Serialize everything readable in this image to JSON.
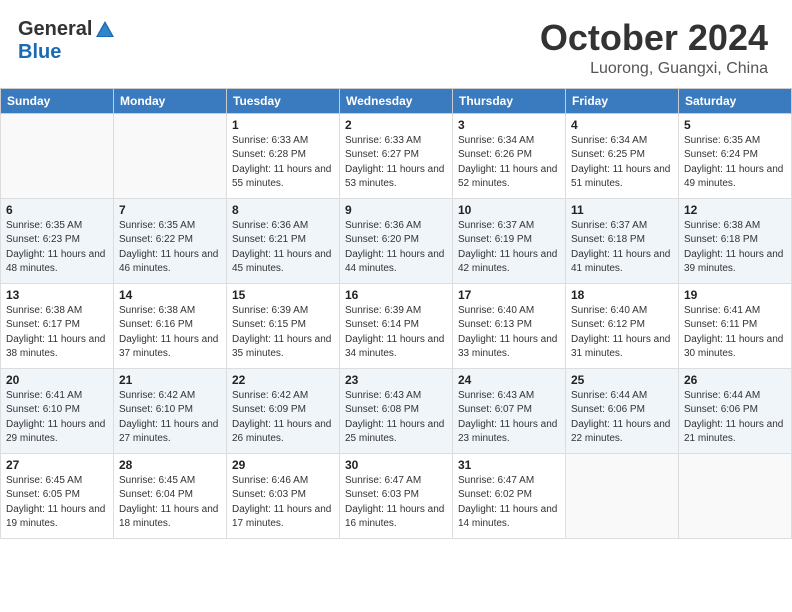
{
  "header": {
    "logo_general": "General",
    "logo_blue": "Blue",
    "month": "October 2024",
    "location": "Luorong, Guangxi, China"
  },
  "days_of_week": [
    "Sunday",
    "Monday",
    "Tuesday",
    "Wednesday",
    "Thursday",
    "Friday",
    "Saturday"
  ],
  "weeks": [
    [
      {
        "day": "",
        "info": ""
      },
      {
        "day": "",
        "info": ""
      },
      {
        "day": "1",
        "info": "Sunrise: 6:33 AM\nSunset: 6:28 PM\nDaylight: 11 hours and 55 minutes."
      },
      {
        "day": "2",
        "info": "Sunrise: 6:33 AM\nSunset: 6:27 PM\nDaylight: 11 hours and 53 minutes."
      },
      {
        "day": "3",
        "info": "Sunrise: 6:34 AM\nSunset: 6:26 PM\nDaylight: 11 hours and 52 minutes."
      },
      {
        "day": "4",
        "info": "Sunrise: 6:34 AM\nSunset: 6:25 PM\nDaylight: 11 hours and 51 minutes."
      },
      {
        "day": "5",
        "info": "Sunrise: 6:35 AM\nSunset: 6:24 PM\nDaylight: 11 hours and 49 minutes."
      }
    ],
    [
      {
        "day": "6",
        "info": "Sunrise: 6:35 AM\nSunset: 6:23 PM\nDaylight: 11 hours and 48 minutes."
      },
      {
        "day": "7",
        "info": "Sunrise: 6:35 AM\nSunset: 6:22 PM\nDaylight: 11 hours and 46 minutes."
      },
      {
        "day": "8",
        "info": "Sunrise: 6:36 AM\nSunset: 6:21 PM\nDaylight: 11 hours and 45 minutes."
      },
      {
        "day": "9",
        "info": "Sunrise: 6:36 AM\nSunset: 6:20 PM\nDaylight: 11 hours and 44 minutes."
      },
      {
        "day": "10",
        "info": "Sunrise: 6:37 AM\nSunset: 6:19 PM\nDaylight: 11 hours and 42 minutes."
      },
      {
        "day": "11",
        "info": "Sunrise: 6:37 AM\nSunset: 6:18 PM\nDaylight: 11 hours and 41 minutes."
      },
      {
        "day": "12",
        "info": "Sunrise: 6:38 AM\nSunset: 6:18 PM\nDaylight: 11 hours and 39 minutes."
      }
    ],
    [
      {
        "day": "13",
        "info": "Sunrise: 6:38 AM\nSunset: 6:17 PM\nDaylight: 11 hours and 38 minutes."
      },
      {
        "day": "14",
        "info": "Sunrise: 6:38 AM\nSunset: 6:16 PM\nDaylight: 11 hours and 37 minutes."
      },
      {
        "day": "15",
        "info": "Sunrise: 6:39 AM\nSunset: 6:15 PM\nDaylight: 11 hours and 35 minutes."
      },
      {
        "day": "16",
        "info": "Sunrise: 6:39 AM\nSunset: 6:14 PM\nDaylight: 11 hours and 34 minutes."
      },
      {
        "day": "17",
        "info": "Sunrise: 6:40 AM\nSunset: 6:13 PM\nDaylight: 11 hours and 33 minutes."
      },
      {
        "day": "18",
        "info": "Sunrise: 6:40 AM\nSunset: 6:12 PM\nDaylight: 11 hours and 31 minutes."
      },
      {
        "day": "19",
        "info": "Sunrise: 6:41 AM\nSunset: 6:11 PM\nDaylight: 11 hours and 30 minutes."
      }
    ],
    [
      {
        "day": "20",
        "info": "Sunrise: 6:41 AM\nSunset: 6:10 PM\nDaylight: 11 hours and 29 minutes."
      },
      {
        "day": "21",
        "info": "Sunrise: 6:42 AM\nSunset: 6:10 PM\nDaylight: 11 hours and 27 minutes."
      },
      {
        "day": "22",
        "info": "Sunrise: 6:42 AM\nSunset: 6:09 PM\nDaylight: 11 hours and 26 minutes."
      },
      {
        "day": "23",
        "info": "Sunrise: 6:43 AM\nSunset: 6:08 PM\nDaylight: 11 hours and 25 minutes."
      },
      {
        "day": "24",
        "info": "Sunrise: 6:43 AM\nSunset: 6:07 PM\nDaylight: 11 hours and 23 minutes."
      },
      {
        "day": "25",
        "info": "Sunrise: 6:44 AM\nSunset: 6:06 PM\nDaylight: 11 hours and 22 minutes."
      },
      {
        "day": "26",
        "info": "Sunrise: 6:44 AM\nSunset: 6:06 PM\nDaylight: 11 hours and 21 minutes."
      }
    ],
    [
      {
        "day": "27",
        "info": "Sunrise: 6:45 AM\nSunset: 6:05 PM\nDaylight: 11 hours and 19 minutes."
      },
      {
        "day": "28",
        "info": "Sunrise: 6:45 AM\nSunset: 6:04 PM\nDaylight: 11 hours and 18 minutes."
      },
      {
        "day": "29",
        "info": "Sunrise: 6:46 AM\nSunset: 6:03 PM\nDaylight: 11 hours and 17 minutes."
      },
      {
        "day": "30",
        "info": "Sunrise: 6:47 AM\nSunset: 6:03 PM\nDaylight: 11 hours and 16 minutes."
      },
      {
        "day": "31",
        "info": "Sunrise: 6:47 AM\nSunset: 6:02 PM\nDaylight: 11 hours and 14 minutes."
      },
      {
        "day": "",
        "info": ""
      },
      {
        "day": "",
        "info": ""
      }
    ]
  ]
}
